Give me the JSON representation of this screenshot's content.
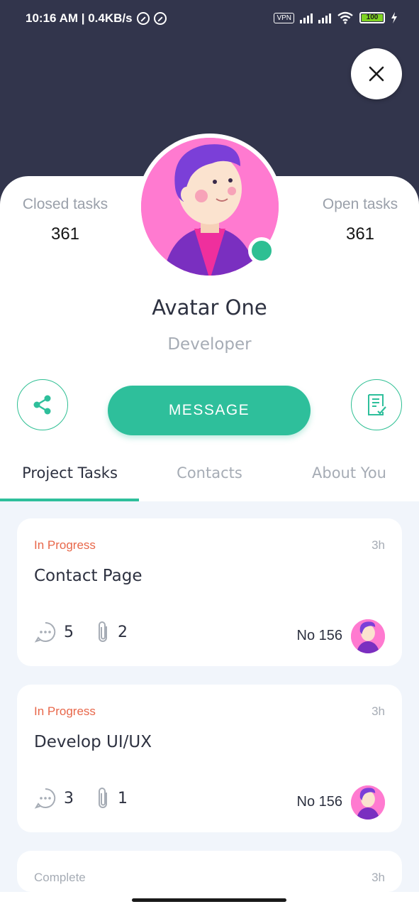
{
  "status_bar": {
    "time_speed": "10:16 AM | 0.4KB/s",
    "vpn": "VPN",
    "battery": "100"
  },
  "profile": {
    "name": "Avatar One",
    "role": "Developer",
    "closed_tasks_label": "Closed tasks",
    "closed_tasks_value": "361",
    "open_tasks_label": "Open tasks",
    "open_tasks_value": "361",
    "online": true
  },
  "actions": {
    "message_label": "MESSAGE"
  },
  "tabs": [
    {
      "label": "Project Tasks",
      "active": true
    },
    {
      "label": "Contacts",
      "active": false
    },
    {
      "label": "About You",
      "active": false
    }
  ],
  "tasks": [
    {
      "status": "In Progress",
      "status_color": "#e8674a",
      "time": "3h",
      "title": "Contact Page",
      "comments": "5",
      "attachments": "2",
      "number": "No 156"
    },
    {
      "status": "In Progress",
      "status_color": "#e8674a",
      "time": "3h",
      "title": "Develop UI/UX",
      "comments": "3",
      "attachments": "1",
      "number": "No 156"
    },
    {
      "status": "Complete",
      "status_color": "#a6acb5",
      "time": "3h",
      "title": "",
      "comments": "",
      "attachments": "",
      "number": ""
    }
  ],
  "colors": {
    "header_bg": "#32354c",
    "accent": "#2ebf9b",
    "in_progress": "#e8674a",
    "list_bg": "#f1f5fb"
  }
}
